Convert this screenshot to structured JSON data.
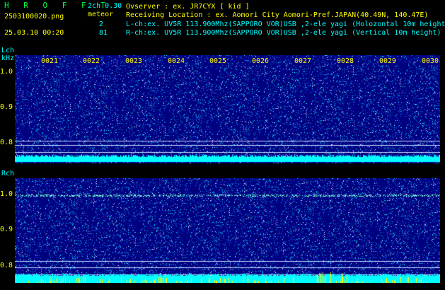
{
  "app": {
    "name": "H R O F F T"
  },
  "file": {
    "name": "2503100020.png",
    "datetime": "25.03.10 00:20"
  },
  "config": {
    "mode": "2ch 0.30",
    "meteor_label": "meteor",
    "lch_count": "2",
    "rch_count": "81"
  },
  "info": {
    "observer": "Ovserver            : ex. JR7CYX [ kid ]",
    "location": "Receiving Location : ex. Aomori City Aomori-Pref.JAPAN(40.49N, 140.47E)",
    "lch": "L-ch:ex. UV5R 113.900Mhz(SAPPORO VOR)USB ,2-ele yagi (Holozontal 10m height)",
    "rch": "R-ch:ex. UV5R 113.900Mhz(SAPPORO VOR)USB ,2-ele yagi (Vertical 10m height)"
  },
  "time_ticks": [
    "0021",
    "0022",
    "0023",
    "0024",
    "0025",
    "0026",
    "0027",
    "0028",
    "0029",
    "0030"
  ],
  "lch_panel": {
    "channel": "Lch",
    "unit": "kHz",
    "y_labels": [
      "1.0",
      "0.9",
      "0.8"
    ]
  },
  "rch_panel": {
    "channel": "Rch",
    "y_labels": [
      "1.0",
      "0.9",
      "0.8"
    ]
  },
  "colors": {
    "background": "#000000",
    "panel": "#00008c",
    "noise_band": "#00ffff",
    "yellow_text": "#ffff00",
    "green_text": "#00ff40"
  }
}
